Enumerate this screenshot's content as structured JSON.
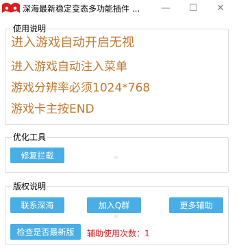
{
  "window": {
    "title": "深海最新稳定变态多功能插件 ...",
    "minimize_glyph": "—",
    "maximize_glyph": "☐",
    "close_glyph": "✕",
    "icon": "mustache-logo-icon",
    "icon_color": "#d81e1e"
  },
  "usage": {
    "legend": "使用说明",
    "lines": [
      "进入游戏自动开启无视",
      "进入游戏自动注入菜单",
      "游戏分辨率必须1024*768",
      "游戏卡主按END"
    ],
    "text_color": "#c2772c"
  },
  "tools": {
    "legend": "优化工具",
    "repair_label": "修复拦截"
  },
  "copyright": {
    "legend": "版权说明",
    "contact_label": "联系深海",
    "join_label": "加入Q群",
    "more_label": "更多辅助",
    "check_label": "检查是否最新版",
    "usage_count_label": "辅助使用次数：1"
  },
  "colors": {
    "button_bg": "#4aaee6",
    "button_text": "#ffffff",
    "count_text": "#e01515"
  }
}
